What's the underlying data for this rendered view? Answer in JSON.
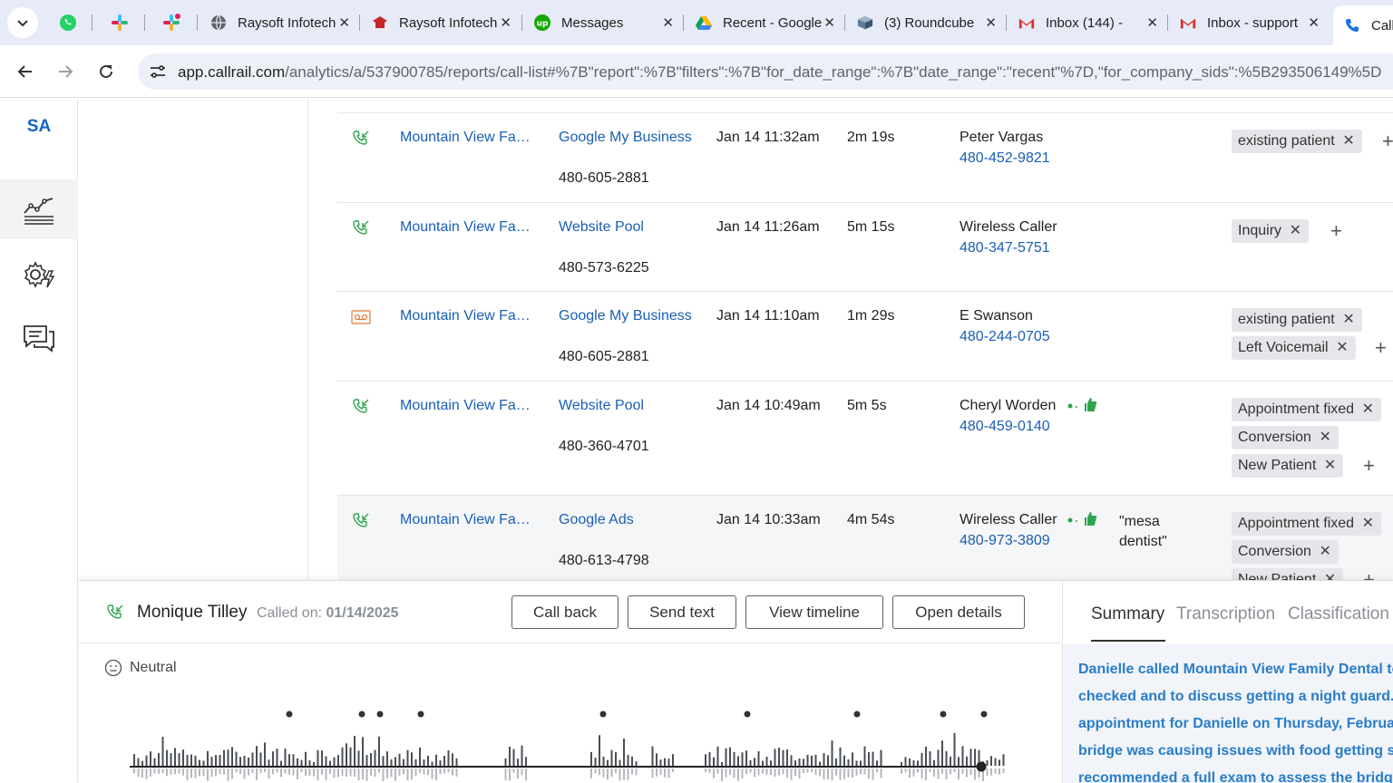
{
  "browser": {
    "tabs": [
      {
        "title": "",
        "icon": "whatsapp-icon",
        "pinned": true
      },
      {
        "title": "",
        "icon": "slack-icon",
        "pinned": true
      },
      {
        "title": "",
        "icon": "slack-icon",
        "pinned": true
      },
      {
        "title": "Raysoft Infotech",
        "icon": "globe-icon"
      },
      {
        "title": "Raysoft Infotech",
        "icon": "raysoft-icon"
      },
      {
        "title": "Messages",
        "icon": "upwork-icon"
      },
      {
        "title": "Recent - Google Drive",
        "icon": "google-drive-icon"
      },
      {
        "title": "(3) Roundcube",
        "icon": "roundcube-icon"
      },
      {
        "title": "Inbox (144) -",
        "icon": "gmail-icon"
      },
      {
        "title": "Inbox - support",
        "icon": "gmail-icon"
      },
      {
        "title": "Call",
        "icon": "callrail-icon",
        "active": true
      }
    ],
    "url_domain": "app.callrail.com",
    "url_path": "/analytics/a/537900785/reports/call-list#%7B\"report\":%7B\"filters\":%7B\"for_date_range\":%7B\"date_range\":\"recent\"%7D,\"for_company_sids\":%5B293506149%5D"
  },
  "nav": {
    "avatar": "SA",
    "items": [
      "analytics-icon",
      "settings-icon",
      "conversations-icon"
    ]
  },
  "calls": [
    {
      "type": "inbound",
      "company": "Mountain View Fa…",
      "source": "Google My Business",
      "tracking_number": "480-605-2881",
      "datetime": "Jan 14 11:32am",
      "duration": "2m 19s",
      "caller": "Peter Vargas",
      "caller_phone": "480-452-9821",
      "keyword": "",
      "sentiment": false,
      "tags": [
        "existing patient"
      ]
    },
    {
      "type": "inbound",
      "company": "Mountain View Fa…",
      "source": "Website Pool",
      "tracking_number": "480-573-6225",
      "datetime": "Jan 14 11:26am",
      "duration": "5m 15s",
      "caller": "Wireless Caller",
      "caller_phone": "480-347-5751",
      "keyword": "",
      "sentiment": false,
      "tags": [
        "Inquiry"
      ]
    },
    {
      "type": "voicemail",
      "company": "Mountain View Fa…",
      "source": "Google My Business",
      "tracking_number": "480-605-2881",
      "datetime": "Jan 14 11:10am",
      "duration": "1m 29s",
      "caller": "E Swanson",
      "caller_phone": "480-244-0705",
      "keyword": "",
      "sentiment": false,
      "tags": [
        "existing patient",
        "Left Voicemail"
      ]
    },
    {
      "type": "inbound",
      "company": "Mountain View Fa…",
      "source": "Website Pool",
      "tracking_number": "480-360-4701",
      "datetime": "Jan 14 10:49am",
      "duration": "5m 5s",
      "caller": "Cheryl Worden",
      "caller_phone": "480-459-0140",
      "keyword": "",
      "sentiment": true,
      "tags": [
        "Appointment fixed",
        "Conversion",
        "New Patient"
      ]
    },
    {
      "type": "inbound",
      "company": "Mountain View Fa…",
      "source": "Google Ads",
      "tracking_number": "480-613-4798",
      "datetime": "Jan 14 10:33am",
      "duration": "4m 54s",
      "caller": "Wireless Caller",
      "caller_phone": "480-973-3809",
      "keyword": "\"mesa dentist\"",
      "sentiment": true,
      "tags": [
        "Appointment fixed",
        "Conversion",
        "New Patient"
      ]
    }
  ],
  "panel": {
    "caller_name": "Monique Tilley",
    "called_on_label": "Called on:",
    "called_on_date": "01/14/2025",
    "buttons": {
      "call_back": "Call back",
      "send_text": "Send text",
      "view_timeline": "View timeline",
      "open_details": "Open details"
    },
    "sentiment": "Neutral",
    "tabs": {
      "summary": "Summary",
      "transcription": "Transcription",
      "classification": "Classification"
    },
    "summary_lines": [
      "Danielle called Mountain View Family Dental to",
      "checked and to discuss getting a night guard. T",
      "appointment for Danielle on Thursday, Februar",
      "bridge was causing issues with food getting stu",
      "recommended a full exam to assess the bridge"
    ]
  },
  "colors": {
    "link": "#1a5fb4",
    "accent_green": "#2ea44f",
    "voicemail": "#e0773a",
    "summary_text": "#2a7dc9"
  }
}
